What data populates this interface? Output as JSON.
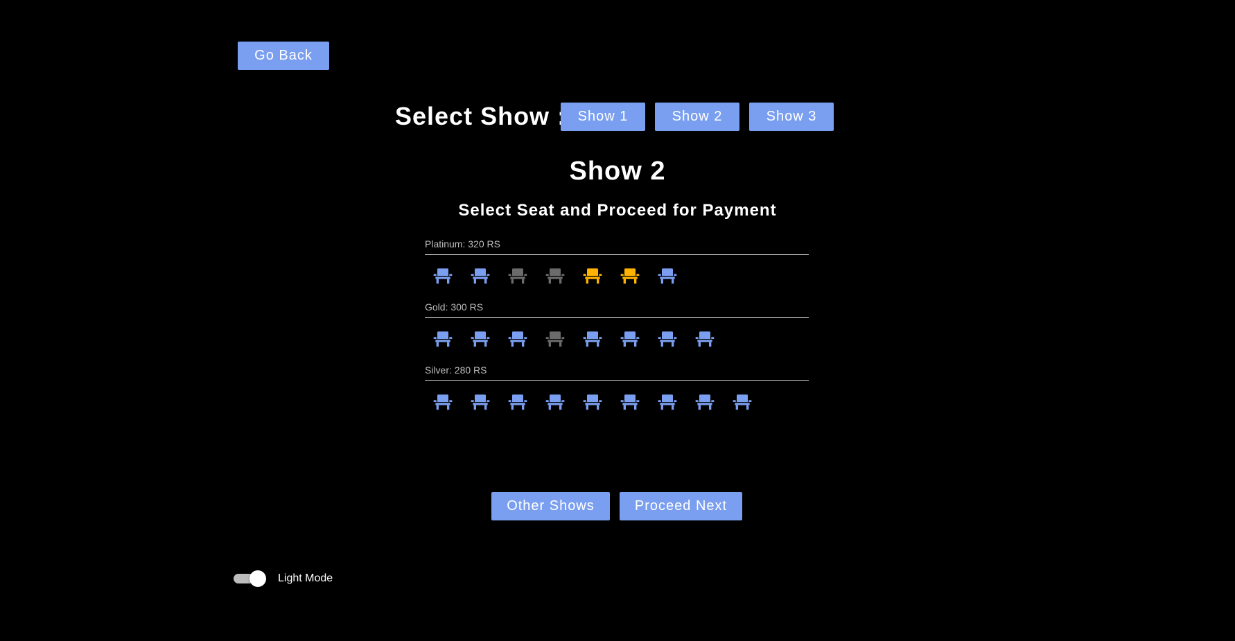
{
  "header": {
    "go_back_label": "Go Back",
    "select_show_label": "Select Show :",
    "show_buttons": [
      "Show 1",
      "Show 2",
      "Show 3"
    ]
  },
  "main": {
    "show_title": "Show 2",
    "subtitle": "Select Seat and Proceed for Payment",
    "categories": [
      {
        "label": "Platinum: 320 RS",
        "seats": [
          "available",
          "available",
          "booked",
          "booked",
          "selected",
          "selected",
          "available"
        ]
      },
      {
        "label": "Gold: 300 RS",
        "seats": [
          "available",
          "available",
          "available",
          "booked",
          "available",
          "available",
          "available",
          "available"
        ]
      },
      {
        "label": "Silver: 280 RS",
        "seats": [
          "available",
          "available",
          "available",
          "available",
          "available",
          "available",
          "available",
          "available",
          "available"
        ]
      }
    ]
  },
  "footer": {
    "other_shows_label": "Other Shows",
    "proceed_next_label": "Proceed Next",
    "theme_toggle_label": "Light Mode",
    "theme_toggle_on": true
  },
  "colors": {
    "accent": "#7b9ff0",
    "seat_available": "#7b9ff0",
    "seat_booked": "#6b6b6b",
    "seat_selected": "#ffb300",
    "background": "#000000"
  },
  "icons": {
    "seat": "seat-icon"
  }
}
